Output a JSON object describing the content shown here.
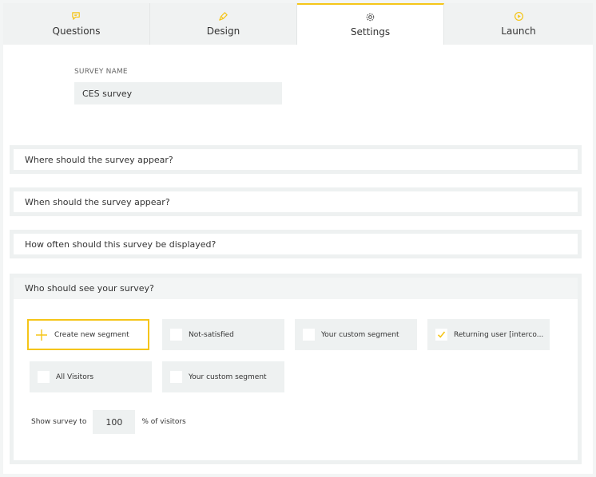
{
  "tabs": [
    {
      "label": "Questions",
      "icon": "chat-icon"
    },
    {
      "label": "Design",
      "icon": "brush-icon"
    },
    {
      "label": "Settings",
      "icon": "gear-icon"
    },
    {
      "label": "Launch",
      "icon": "play-icon"
    }
  ],
  "active_tab": "Settings",
  "accent_color": "#f5c518",
  "survey_name": {
    "label": "SURVEY NAME",
    "value": "CES survey"
  },
  "sections": {
    "where": "Where should the survey appear?",
    "when": "When should the survey appear?",
    "how_often": "How often should this survey be displayed?",
    "who": "Who should see your survey?"
  },
  "segments": {
    "create": "Create new segment",
    "items": [
      {
        "label": "Not-satisfied",
        "checked": false
      },
      {
        "label": "Your custom segment",
        "checked": false
      },
      {
        "label": "Returning user [interco...",
        "checked": true
      },
      {
        "label": "All Visitors",
        "checked": false
      },
      {
        "label": "Your custom segment",
        "checked": false
      }
    ]
  },
  "show_survey": {
    "prefix": "Show survey to",
    "value": "100",
    "suffix": "% of visitors"
  }
}
